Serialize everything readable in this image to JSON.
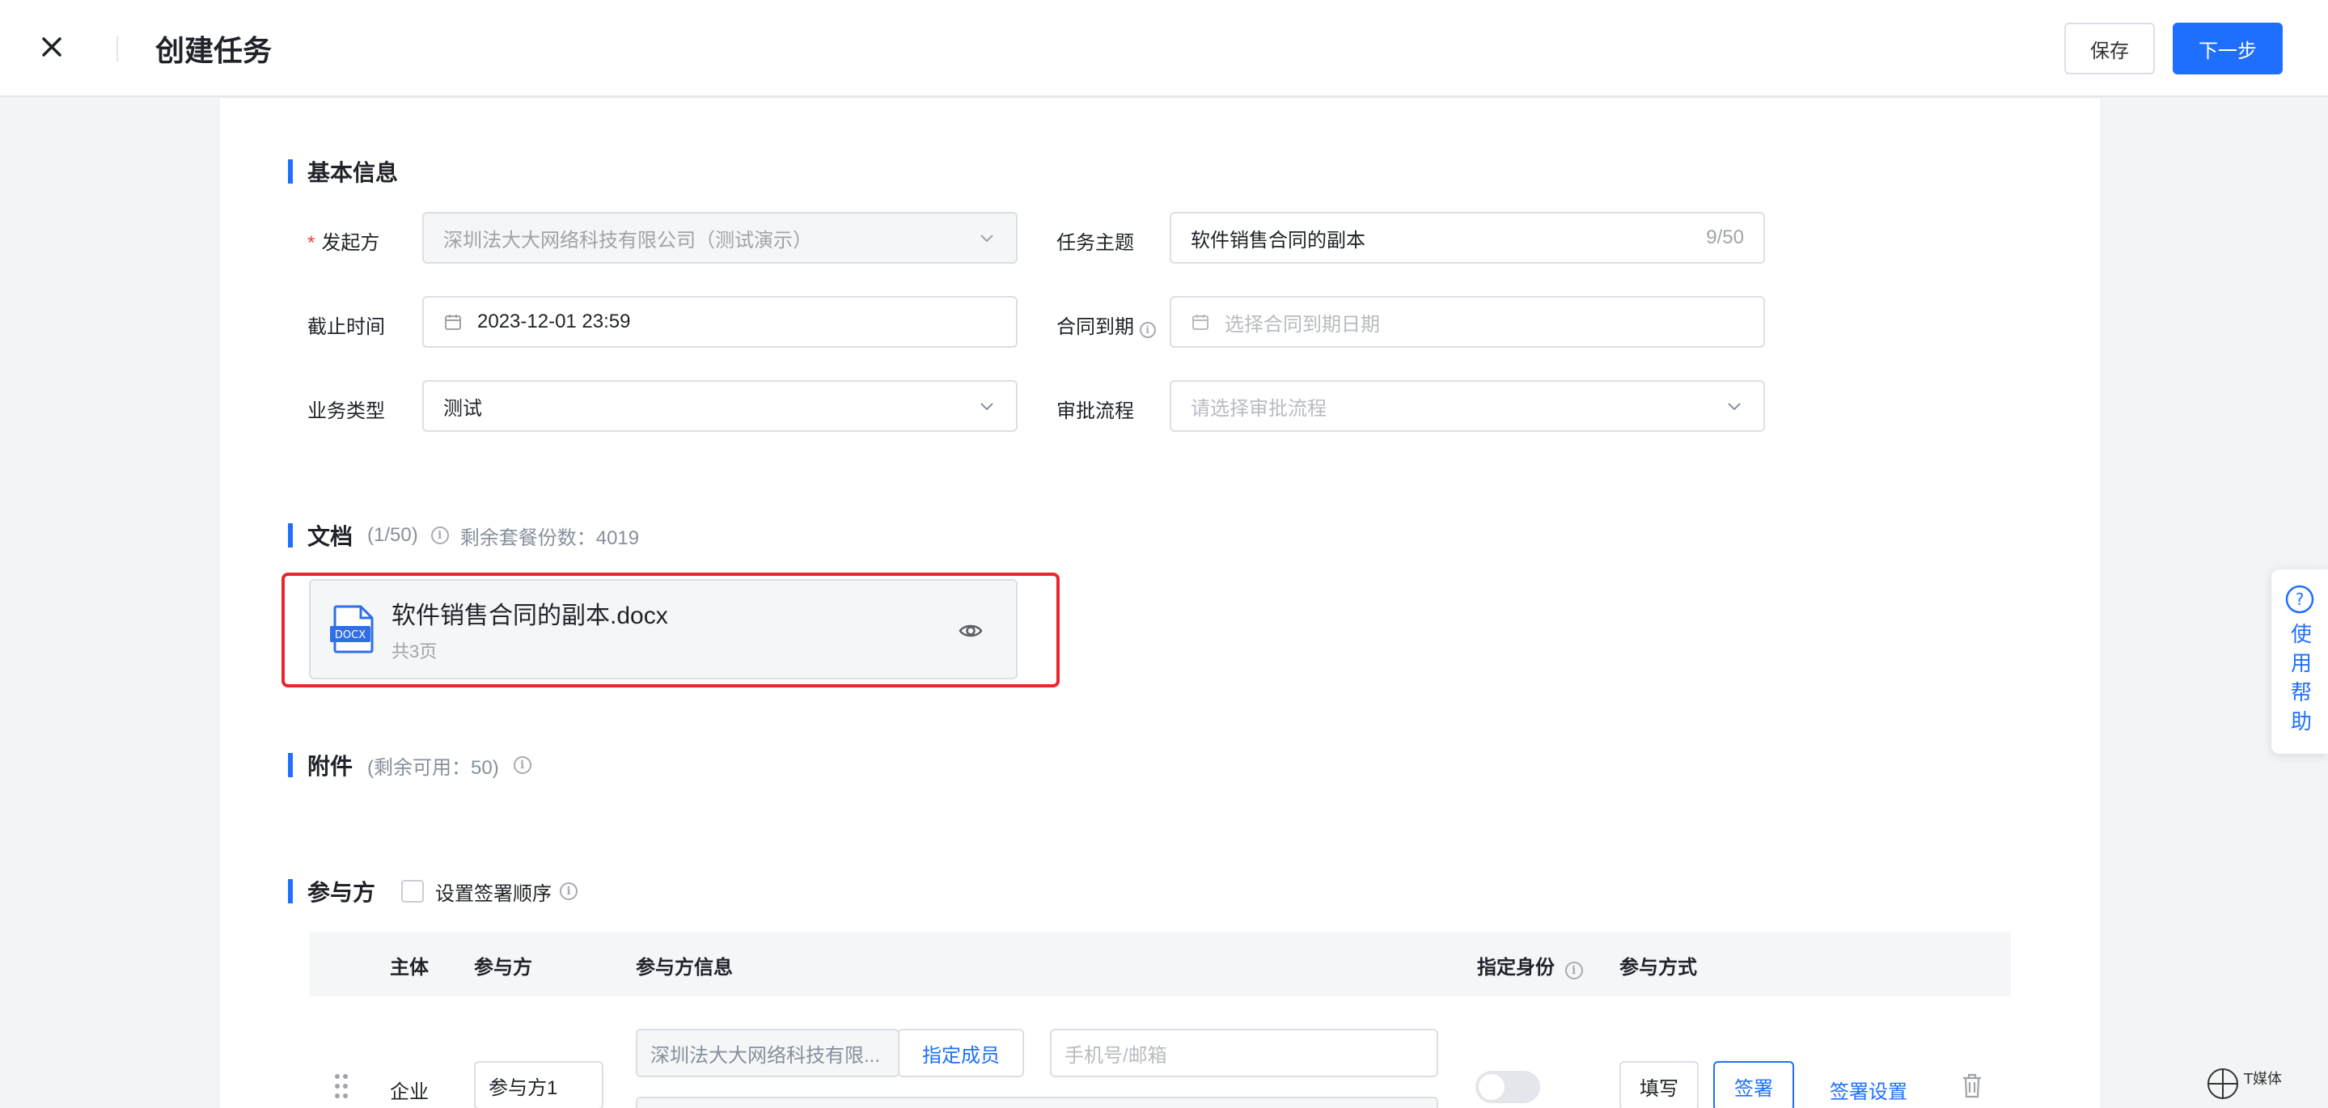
{
  "header": {
    "title": "创建任务",
    "save_label": "保存",
    "next_label": "下一步",
    "close_icon": "close-icon"
  },
  "basic_info": {
    "section_title": "基本信息",
    "initiator": {
      "label": "发起方",
      "required": "*",
      "value": "深圳法大大网络科技有限公司（测试演示）"
    },
    "subject": {
      "label": "任务主题",
      "value": "软件销售合同的副本",
      "counter": "9/50"
    },
    "deadline": {
      "label": "截止时间",
      "value": "2023-12-01 23:59"
    },
    "contract_expiry": {
      "label": "合同到期",
      "placeholder": "选择合同到期日期"
    },
    "business_type": {
      "label": "业务类型",
      "value": "测试"
    },
    "approval_flow": {
      "label": "审批流程",
      "placeholder": "请选择审批流程"
    }
  },
  "documents": {
    "section_title": "文档",
    "count": "(1/50)",
    "remaining": "剩余套餐份数：4019",
    "items": [
      {
        "name": "软件销售合同的副本.docx",
        "pages": "共3页",
        "icon_text": "DOCX"
      }
    ],
    "highlight_color": "#e8262c"
  },
  "attachments": {
    "section_title": "附件",
    "remaining": "(剩余可用：50)"
  },
  "participants": {
    "section_title": "参与方",
    "order_checkbox_label": "设置签署顺序",
    "columns": [
      "主体",
      "参与方",
      "参与方信息",
      "指定身份",
      "参与方式"
    ],
    "rows": [
      {
        "entity": "企业",
        "participant": "参与方1",
        "company": "深圳法大大网络科技有限...",
        "assign_member": "指定成员",
        "contact_placeholder": "手机号/邮箱",
        "fill_label": "填写",
        "sign_label": "签署",
        "sign_settings": "签署设置"
      }
    ]
  },
  "help": {
    "label": "使用帮助"
  },
  "watermark": {
    "text": "T媒体"
  },
  "colors": {
    "accent": "#1f6fff",
    "required": "#f53f3f"
  }
}
